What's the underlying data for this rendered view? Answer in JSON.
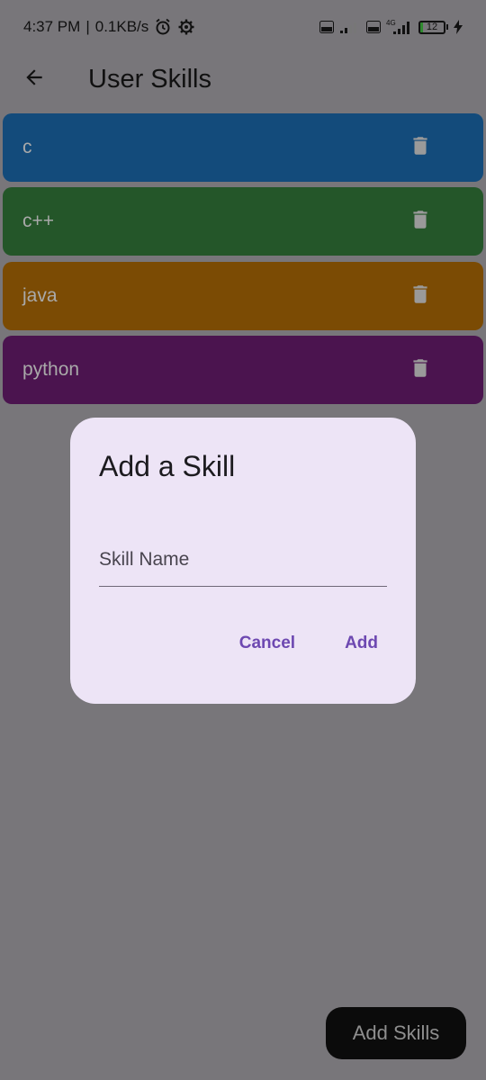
{
  "status_bar": {
    "time": "4:37 PM",
    "separator": "|",
    "speed": "0.1KB/s",
    "battery_level": "12",
    "network": "4G"
  },
  "app_bar": {
    "title": "User Skills"
  },
  "skills": [
    {
      "label": "c",
      "color": "#134b7b"
    },
    {
      "label": "c++",
      "color": "#245629"
    },
    {
      "label": "java",
      "color": "#7b4b04"
    },
    {
      "label": "python",
      "color": "#4b144f"
    }
  ],
  "dialog": {
    "title": "Add a Skill",
    "field_placeholder": "Skill Name",
    "field_value": "",
    "cancel_label": "Cancel",
    "add_label": "Add"
  },
  "fab": {
    "label": "Add Skills"
  },
  "colors": {
    "scrim_background": "#78767a",
    "dialog_background": "#ede4f6",
    "accent": "#6d48b1"
  },
  "icons": {
    "back": "arrow-left-icon",
    "delete": "trash-icon",
    "alarm": "alarm-icon",
    "settings": "gear-icon",
    "signal": "signal-icon",
    "volte": "volte-icon",
    "charging": "bolt-icon"
  }
}
